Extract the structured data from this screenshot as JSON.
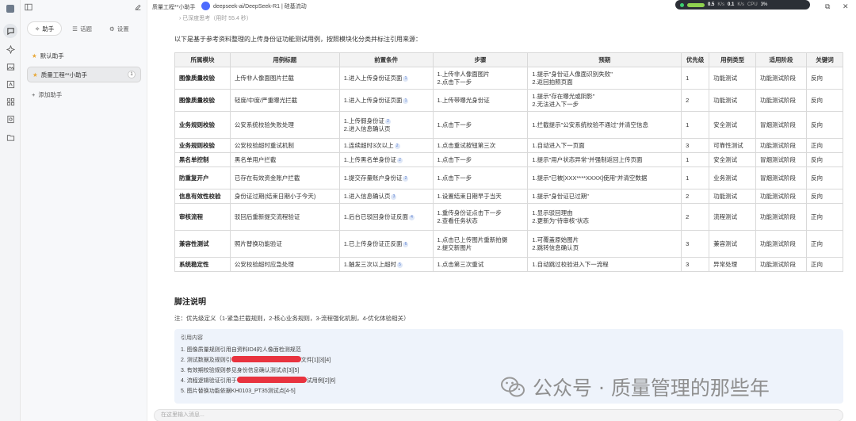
{
  "window": {
    "title": "质量工程**小助手",
    "model": "deepseek-ai/DeepSeek-R1 | 硅基流动"
  },
  "status_pill": {
    "net_up": "0.5",
    "net_up_unit": "K/s",
    "net_down": "0.1",
    "net_down_unit": "K/s",
    "cpu_label": "CPU",
    "cpu_value": "3%"
  },
  "sidebar": {
    "tabs": [
      {
        "label": "助手",
        "icon": "sparkle-icon"
      },
      {
        "label": "话题",
        "icon": "list-icon"
      },
      {
        "label": "设置",
        "icon": "gear-icon"
      }
    ],
    "assistants": [
      {
        "label": "默认助手",
        "icon": "star-icon"
      },
      {
        "label": "质量工程**小助手",
        "icon": "star-icon",
        "count": "1"
      }
    ],
    "add_label": "添加助手"
  },
  "main": {
    "thinking_label": "已深度思考（用时 55.4 秒）",
    "intro": "以下是基于参考资料整理的上传身份证功能测试用例，按照模块化分类并标注引用来源：",
    "table": {
      "headers": [
        "所属模块",
        "用例标题",
        "前置条件",
        "步骤",
        "预期",
        "优先级",
        "用例类型",
        "适用阶段",
        "关键词"
      ],
      "rows": [
        {
          "module": "图像质量校验",
          "title": "上传非人像面图片拦截",
          "pre": [
            "1.进入上传身份证页面"
          ],
          "pre_cite": [
            "1"
          ],
          "steps": [
            "1.上传非人像面图片",
            "2.点击下一步"
          ],
          "expect": [
            "1.提示\"身份证人像面识别失败\"",
            "2.返回拍照页面"
          ],
          "priority": "1",
          "type": "功能测试",
          "stage": "功能测试阶段",
          "keyword": "反向"
        },
        {
          "module": "图像质量校验",
          "title": "轻度/中度/严重曝光拦截",
          "pre": [
            "1.进入上传身份证页面"
          ],
          "pre_cite": [
            "1"
          ],
          "steps": [
            "1.上传带曝光身份证"
          ],
          "expect": [
            "1.提示\"存在曝光或阴影\"",
            "2.无法进入下一步"
          ],
          "priority": "2",
          "type": "功能测试",
          "stage": "功能测试阶段",
          "keyword": "反向"
        },
        {
          "module": "业务规则校验",
          "title": "公安系统校验失败处理",
          "pre": [
            "1.上传假身份证",
            "2.进入信息确认页"
          ],
          "pre_cite": [
            "2",
            ""
          ],
          "steps": [
            "1.点击下一步"
          ],
          "expect": [
            "1.拦截提示\"公安系统校验不通过\"并清空信息"
          ],
          "priority": "1",
          "type": "安全测试",
          "stage": "冒烟测试阶段",
          "keyword": "反向"
        },
        {
          "module": "业务规则校验",
          "title": "公安校验超时重试机制",
          "pre": [
            "1.连续超时3次以上"
          ],
          "pre_cite": [
            "2"
          ],
          "steps": [
            "1.点击重试按钮第三次"
          ],
          "expect": [
            "1.自动进入下一页面"
          ],
          "priority": "3",
          "type": "可靠性测试",
          "stage": "功能测试阶段",
          "keyword": "正向"
        },
        {
          "module": "黑名单控制",
          "title": "黑名单用户拦截",
          "pre": [
            "1.上传黑名单身份证"
          ],
          "pre_cite": [
            "2"
          ],
          "steps": [
            "1.点击下一步"
          ],
          "expect": [
            "1.提示\"用户状态异常\"并强制返回上传页面"
          ],
          "priority": "1",
          "type": "安全测试",
          "stage": "冒烟测试阶段",
          "keyword": "反向"
        },
        {
          "module": "防重复开户",
          "title": "已存在有效资金账户拦截",
          "pre": [
            "1.提交存量账户身份证"
          ],
          "pre_cite": [
            "2"
          ],
          "steps": [
            "1.点击下一步"
          ],
          "expect": [
            "1.提示\"已被[XXX****XXXX]使用\"并清空数据"
          ],
          "priority": "1",
          "type": "业务测试",
          "stage": "冒烟测试阶段",
          "keyword": "反向"
        },
        {
          "module": "信息有效性校验",
          "title": "身份证过期(结束日期小于今天)",
          "pre": [
            "1.进入信息确认页"
          ],
          "pre_cite": [
            "3"
          ],
          "steps": [
            "1.设置结束日期早于当天"
          ],
          "expect": [
            "1.提示\"身份证已过期\""
          ],
          "priority": "2",
          "type": "功能测试",
          "stage": "功能测试阶段",
          "keyword": "反向"
        },
        {
          "module": "审核流程",
          "title": "驳回后重新提交流程验证",
          "pre": [
            "1.后台已驳回身份证反面"
          ],
          "pre_cite": [
            "4"
          ],
          "steps": [
            "1.重传身份证点击下一步",
            "2.查看任务状态"
          ],
          "expect": [
            "1.显示驳回理由",
            "2.更新为\"待审核\"状态"
          ],
          "priority": "2",
          "type": "流程测试",
          "stage": "功能测试阶段",
          "keyword": "正向"
        },
        {
          "module": "兼容性测试",
          "title": "照片替换功能验证",
          "pre": [
            "1.已上传身份证正反面"
          ],
          "pre_cite": [
            "6"
          ],
          "steps": [
            "1.点击已上传图片重新拍摄",
            "2.提交新图片"
          ],
          "expect": [
            "1.可覆盖原始图片",
            "2.跳转信息确认页"
          ],
          "priority": "3",
          "type": "兼容测试",
          "stage": "功能测试阶段",
          "keyword": "正向"
        },
        {
          "module": "系统稳定性",
          "title": "公安校验超时应急处理",
          "pre": [
            "1.触发三次以上超时"
          ],
          "pre_cite": [
            "5"
          ],
          "steps": [
            "1.点击第三次重试"
          ],
          "expect": [
            "1.自动跳过校验进入下一流程"
          ],
          "priority": "3",
          "type": "异常处理",
          "stage": "功能测试阶段",
          "keyword": "正向"
        }
      ]
    },
    "footnote_title": "脚注说明",
    "footnote_note": "注：优先级定义（1-紧急拦截规则，2-核心业务规则，3-流程强化机制，4-优化体验相关）",
    "refs": {
      "title": "引用内容",
      "items": [
        {
          "n": "1.",
          "a": "图像质量规则引用自资料ID4的人像面检测规范",
          "b": ""
        },
        {
          "n": "2.",
          "a": "测试数据及规则引",
          "b": "文件[1][3][4]"
        },
        {
          "n": "3.",
          "a": "有效期校验规则参见身份信息确认测试点[3][5]",
          "b": ""
        },
        {
          "n": "4.",
          "a": "流程逻辑验证引用于",
          "b": "试用例[2][6]"
        },
        {
          "n": "5.",
          "a": "图片替换功能依据KH0103_PT35测试点[4-5]",
          "b": ""
        }
      ]
    },
    "watermark": "公众号 · 质量管理的那些年",
    "input_placeholder": "在这里输入消息..."
  }
}
